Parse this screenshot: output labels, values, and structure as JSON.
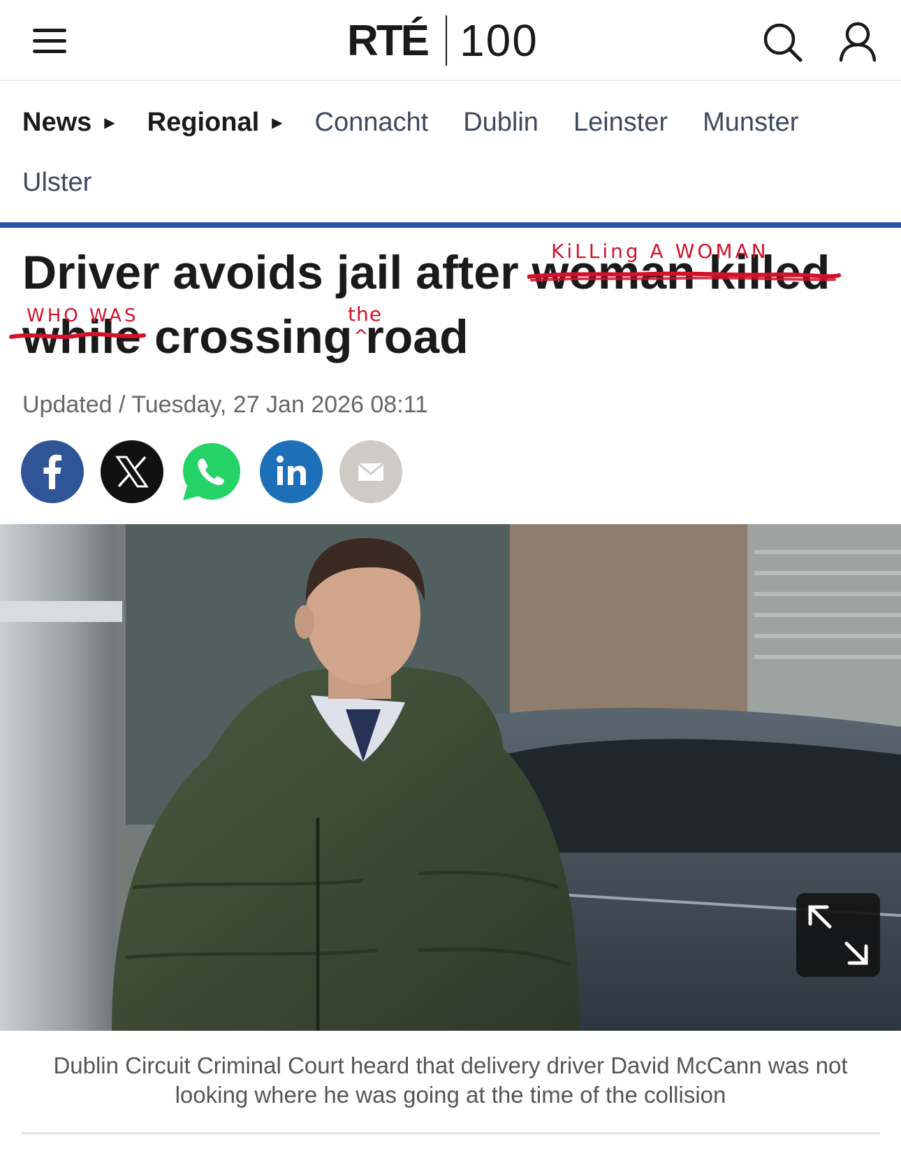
{
  "header": {
    "logo_main": "RTÉ",
    "logo_suffix": "100",
    "menu_icon": "hamburger-menu-icon",
    "search_icon": "search-icon",
    "account_icon": "user-icon"
  },
  "breadcrumb": {
    "items": [
      "News",
      "Regional"
    ],
    "regions": [
      "Connacht",
      "Dublin",
      "Leinster",
      "Munster",
      "Ulster"
    ]
  },
  "article": {
    "headline": {
      "part1": "Driver avoids jail after",
      "struck1": "woman killed",
      "struck2": "while",
      "part2": "crossing",
      "part3": "road"
    },
    "annotations": {
      "replace1": "KiLLing A WOMAN",
      "replace2": "WHO WAS",
      "insert": "the",
      "caret": "^"
    },
    "dateline": "Updated / Tuesday, 27 Jan 2026 08:11",
    "share": [
      {
        "name": "facebook",
        "icon": "facebook-icon",
        "color": "#2f5597"
      },
      {
        "name": "x",
        "icon": "x-icon",
        "color": "#111111"
      },
      {
        "name": "whatsapp",
        "icon": "whatsapp-icon",
        "color": "#25d366"
      },
      {
        "name": "linkedin",
        "icon": "linkedin-icon",
        "color": "#1d6fb8"
      },
      {
        "name": "email",
        "icon": "email-icon",
        "color": "#cfcac4"
      }
    ],
    "photo": {
      "expand_icon": "expand-icon"
    },
    "caption": "Dublin Circuit Criminal Court heard that delivery driver David McCann was not looking where he was going at the time of the collision"
  },
  "colors": {
    "accent_rule": "#2a51a8",
    "annotation_red": "#d3122a"
  }
}
